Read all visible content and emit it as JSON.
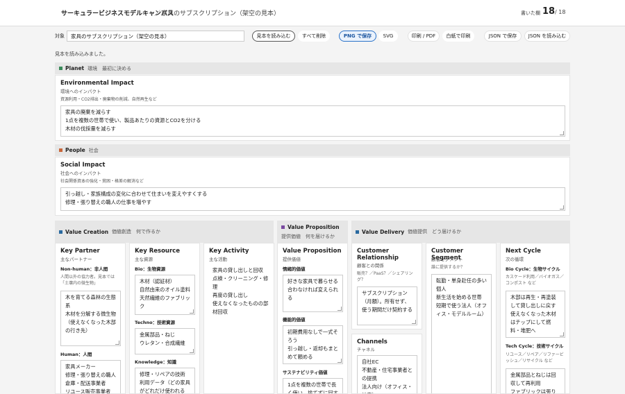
{
  "header": {
    "app_title": "サーキュラービジネスモデルキャンバス",
    "separator": "／",
    "doc_name": "家具のサブスクリプション（架空の見本）",
    "count_label": "書いた欄",
    "count_value": "18",
    "count_total": "/ 18"
  },
  "toolbar": {
    "subject_label": "対象",
    "subject_value": "家具のサブスクリプション（架空の見本）",
    "load_sample": "見本を読み込む",
    "clear_all": "すべて削除",
    "save_png": "PNG で保存",
    "svg": "SVG",
    "print_pdf": "印刷 / PDF",
    "print_blank": "白紙で印刷",
    "save_json": "JSON で保存",
    "load_json": "JSON を読み込む"
  },
  "status": "見本を読み込みました。",
  "planet": {
    "en": "Planet",
    "jp": "環境　最初に決める",
    "color": "#3a8a5a",
    "card": {
      "title": "Environmental Impact",
      "sub": "環境へのインパクト",
      "hint": "資源利用・CO2排出・廃棄物の削減、自然再生など",
      "text": "家具の廃棄を減らす\n1点を複数の世帯で使い、製品あたりの資源とCO2を分ける\n木材の伐採量を減らす"
    }
  },
  "people": {
    "en": "People",
    "jp": "社会",
    "color": "#c8663a",
    "card": {
      "title": "Social Impact",
      "sub": "社会へのインパクト",
      "hint": "社会関係資本の強化・貧困・格差の解消など",
      "text": "引っ越し・家族構成の変化に合わせて住まいを変えやすくする\n修理・張り替えの職人の仕事を増やす"
    }
  },
  "value_creation": {
    "en": "Value Creation",
    "jp": "価値創造　何で作るか",
    "color": "#2a6aa0"
  },
  "value_proposition_bar": {
    "en": "Value Proposition",
    "jp": "提供価値　何を届けるか",
    "color": "#7a4aa0"
  },
  "value_delivery": {
    "en": "Value Delivery",
    "jp": "価値提供　どう届けるか",
    "color": "#2a6aa0"
  },
  "columns": {
    "key_partner": {
      "title": "Key Partner",
      "sub": "主なパートナー",
      "h1": "Non-human：非人間",
      "n1": "人間以外の協力者。見本では「土壌内の微生物」",
      "t1": "木を育てる森林の生態系\n木材を分解する微生物（使えなくなった木部の行き先）",
      "h2": "Human：人間",
      "t2": "家具メーカー\n修理・張り替えの職人\n倉庫・配送事業者\nリユース販売事業者"
    },
    "key_resource": {
      "title": "Key Resource",
      "sub": "主な資源",
      "h1": "Bio：生物資源",
      "t1": "木材（認証材）\n自然由来のオイル塗料\n天然繊維のファブリック",
      "h2": "Techno：技術資源",
      "t2": "金属部品・ねじ\nウレタン・合成繊維",
      "h3": "Knowledge：知識",
      "t3": "修理・リペアの技術\n利用データ（どの家具がどれだけ使われる"
    },
    "key_activity": {
      "title": "Key Activity",
      "sub": "主な活動",
      "text": "家具の貸し出しと回収\n点検・クリーニング・修理\n再度の貸し出し\n使えなくなったものの部材回収"
    },
    "value_proposition": {
      "title": "Value Proposition",
      "sub": "提供価値",
      "h1": "情緒的価値",
      "t1": "好きな家具で暮らせる\n合わなければ変えられる",
      "h2": "機能的価値",
      "t2": "初期費用なしで一式そろう\n引っ越し・返却もまとめて頼める",
      "h3": "サステナビリティ価値",
      "t3": "1点を複数の世帯で長く使い、捨てずに回す"
    },
    "customer_relationship": {
      "title": "Customer Relationship",
      "sub": "顧客との関係",
      "n1": "販売？／PaaS？／シェアリング？",
      "text": "サブスクリプション（月額）。所有せず、使う期間だけ契約する"
    },
    "channels": {
      "title": "Channels",
      "sub": "チャネル",
      "text": "自社EC\n不動産・住宅事業者との提携\n法人向け（オフィス・社宅）"
    },
    "customer_segment": {
      "title": "Customer Segment",
      "sub": "顧客セグメント",
      "n1": "誰に提供するか？",
      "text": "転勤・単身赴任の多い個人\n新生活を始める世帯\n短期で使う法人（オフィス・モデルルーム）"
    },
    "next_cycle": {
      "title": "Next Cycle",
      "sub": "次の循環",
      "h1": "Bio Cycle：生物サイクル",
      "n1": "カスケード利用／バイオガス／コンポスト など",
      "t1": "木部は再生・再塗装して貸し出しに戻す\n使えなくなった木材はチップにして燃料・堆肥へ",
      "h2": "Tech Cycle：技術サイクル",
      "n2": "リユース／リペア／リファービッシュ／リサイクル など",
      "t2": "金属部品とねじは回収して再利用\nファブリックは張り替"
    }
  }
}
